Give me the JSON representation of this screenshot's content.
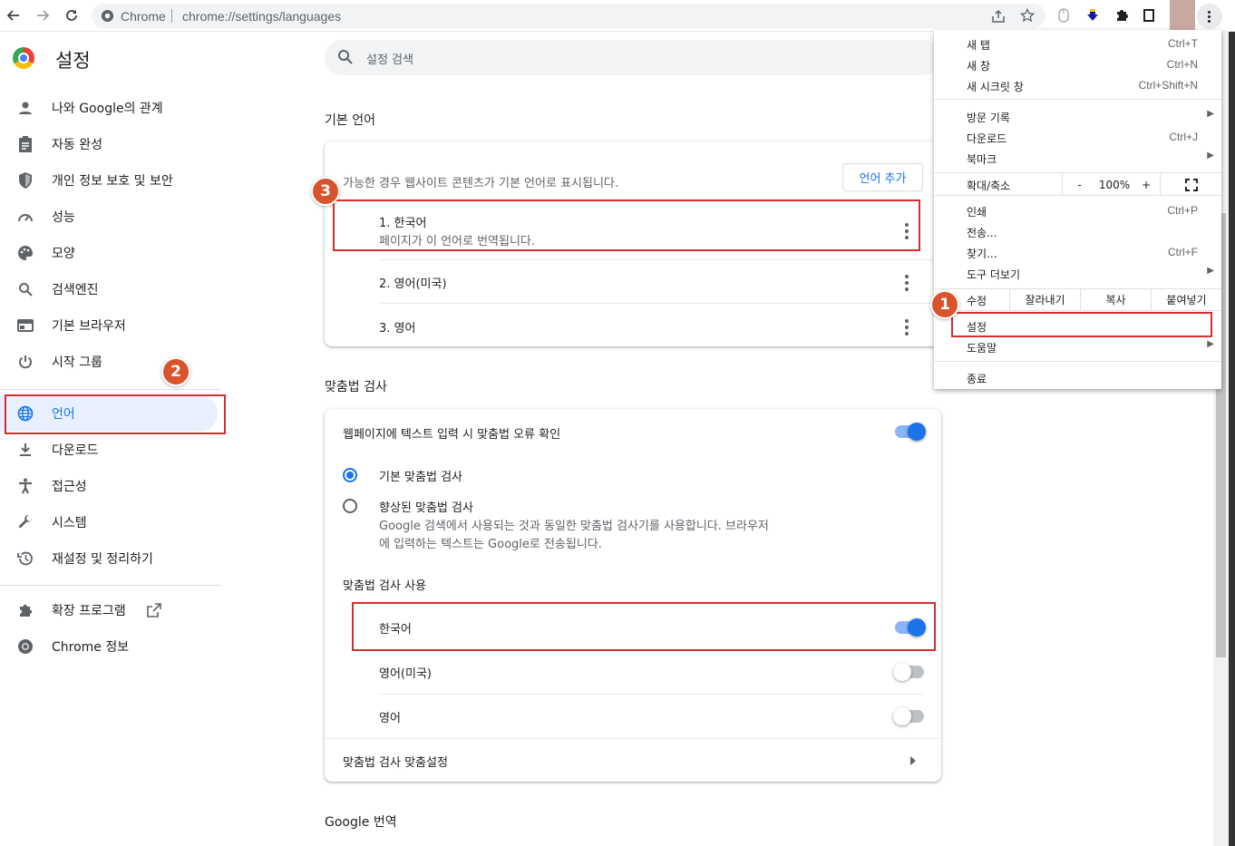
{
  "browser": {
    "site_chip": "Chrome",
    "url": "chrome://settings/languages"
  },
  "header": {
    "title": "설정",
    "search_placeholder": "설정 검색"
  },
  "sidebar": {
    "items": [
      {
        "label": "나와 Google의 관계",
        "icon": "person-icon"
      },
      {
        "label": "자동 완성",
        "icon": "clipboard-icon"
      },
      {
        "label": "개인 정보 보호 및 보안",
        "icon": "shield-icon"
      },
      {
        "label": "성능",
        "icon": "speedometer-icon"
      },
      {
        "label": "모양",
        "icon": "palette-icon"
      },
      {
        "label": "검색엔진",
        "icon": "search-icon"
      },
      {
        "label": "기본 브라우저",
        "icon": "browser-icon"
      },
      {
        "label": "시작 그룹",
        "icon": "power-icon"
      },
      {
        "label": "언어",
        "icon": "globe-icon",
        "active": true
      },
      {
        "label": "다운로드",
        "icon": "download-icon"
      },
      {
        "label": "접근성",
        "icon": "accessibility-icon"
      },
      {
        "label": "시스템",
        "icon": "wrench-icon"
      },
      {
        "label": "재설정 및 정리하기",
        "icon": "restore-icon"
      },
      {
        "label": "확장 프로그램",
        "icon": "puzzle-icon"
      },
      {
        "label": "Chrome 정보",
        "icon": "chrome-icon"
      }
    ]
  },
  "languages": {
    "section_title": "기본 언어",
    "description": "가능한 경우 웹사이트 콘텐츠가 기본 언어로 표시됩니다.",
    "add_button": "언어 추가",
    "items": [
      {
        "label": "1. 한국어",
        "sub": "페이지가 이 언어로 번역됩니다."
      },
      {
        "label": "2. 영어(미국)"
      },
      {
        "label": "3. 영어"
      }
    ]
  },
  "spellcheck": {
    "section_title": "맞춤법 검사",
    "main_toggle_label": "웹페이지에 텍스트 입력 시 맞춤법 오류 확인",
    "main_toggle_on": true,
    "basic_label": "기본 맞춤법 검사",
    "enhanced_label": "향상된 맞춤법 검사",
    "enhanced_desc_1": "Google 검색에서 사용되는 것과 동일한 맞춤법 검사기를 사용합니다. 브라우저",
    "enhanced_desc_2": "에 입력하는 텍스트는 Google로 전송됩니다.",
    "use_title": "맞춤법 검사 사용",
    "langs": [
      {
        "label": "한국어",
        "on": true
      },
      {
        "label": "영어(미국)",
        "on": false
      },
      {
        "label": "영어",
        "on": false
      }
    ],
    "customize_label": "맞춤법 검사 맞춤설정"
  },
  "translate": {
    "section_title": "Google 번역"
  },
  "badges": [
    "1",
    "2",
    "3"
  ],
  "menu": {
    "new_tab": "새 탭",
    "new_tab_sc": "Ctrl+T",
    "new_window": "새 창",
    "new_window_sc": "Ctrl+N",
    "incognito": "새 시크릿 창",
    "incognito_sc": "Ctrl+Shift+N",
    "history": "방문 기록",
    "downloads": "다운로드",
    "downloads_sc": "Ctrl+J",
    "bookmarks": "북마크",
    "zoom": "확대/축소",
    "zoom_minus": "-",
    "zoom_value": "100%",
    "zoom_plus": "+",
    "print": "인쇄",
    "print_sc": "Ctrl+P",
    "cast": "전송...",
    "find": "찾기...",
    "find_sc": "Ctrl+F",
    "more_tools": "도구 더보기",
    "edit": "수정",
    "cut": "잘라내기",
    "copy": "복사",
    "paste": "붙여넣기",
    "settings": "설정",
    "help": "도움말",
    "exit": "종료"
  }
}
